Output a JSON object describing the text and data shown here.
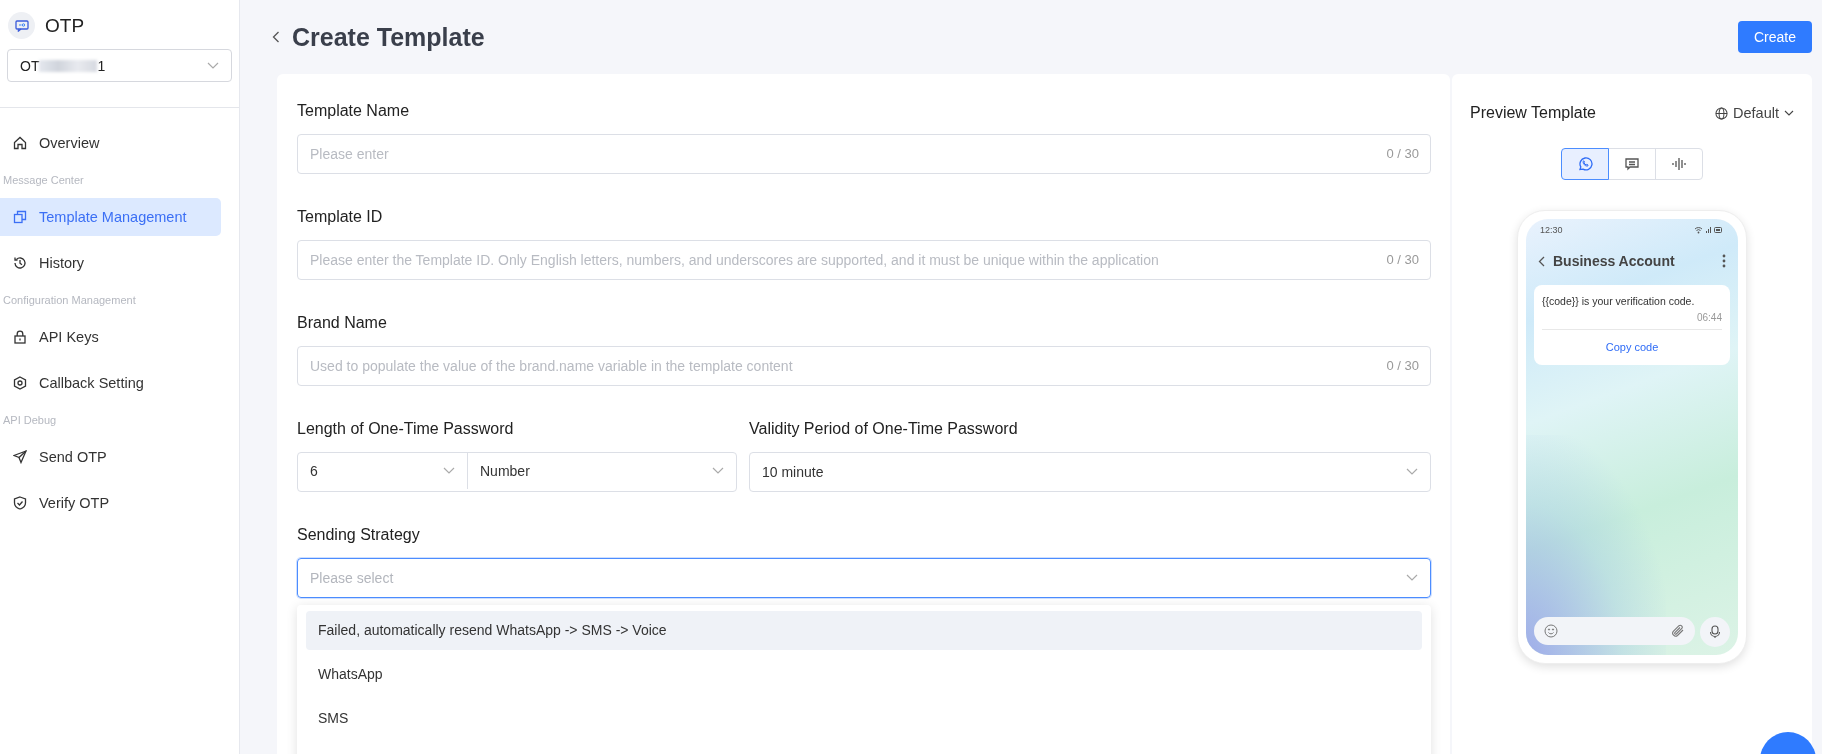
{
  "app": {
    "name": "OTP",
    "selector": {
      "value_start": "OT",
      "value_end": "1"
    }
  },
  "sidebar": {
    "items": [
      {
        "kind": "item",
        "label": "Overview",
        "selected": false
      },
      {
        "kind": "section",
        "label": "Message Center"
      },
      {
        "kind": "item",
        "label": "Template Management",
        "selected": true
      },
      {
        "kind": "item",
        "label": "History",
        "selected": false
      },
      {
        "kind": "section",
        "label": "Configuration Management"
      },
      {
        "kind": "item",
        "label": "API Keys",
        "selected": false
      },
      {
        "kind": "item",
        "label": "Callback Setting",
        "selected": false
      },
      {
        "kind": "section",
        "label": "API Debug"
      },
      {
        "kind": "item",
        "label": "Send OTP",
        "selected": false
      },
      {
        "kind": "item",
        "label": "Verify OTP",
        "selected": false
      }
    ]
  },
  "header": {
    "title": "Create Template",
    "create_button": "Create"
  },
  "form": {
    "text_fields": [
      {
        "label": "Template Name",
        "placeholder": "Please enter",
        "count": "0 / 30"
      },
      {
        "label": "Template ID",
        "placeholder": "Please enter the Template ID. Only English letters, numbers, and underscores are supported, and it must be unique within the application",
        "count": "0 / 30"
      },
      {
        "label": "Brand Name",
        "placeholder": "Used to populate the value of the brand.name variable in the template content",
        "count": "0 / 30"
      }
    ],
    "password_length": {
      "label": "Length of One-Time Password",
      "digits": "6",
      "type": "Number"
    },
    "validity": {
      "label": "Validity Period of One-Time Password",
      "value": "10 minute"
    },
    "sending_strategy": {
      "label": "Sending Strategy",
      "placeholder": "Please select",
      "focused": true,
      "options": [
        {
          "label": "Failed, automatically resend WhatsApp -> SMS -> Voice",
          "highlighted": true
        },
        {
          "label": "WhatsApp",
          "highlighted": false
        },
        {
          "label": "SMS",
          "highlighted": false
        }
      ]
    }
  },
  "preview": {
    "title": "Preview Template",
    "language": "Default",
    "channels": [
      {
        "selected": true
      },
      {
        "selected": false
      },
      {
        "selected": false
      }
    ],
    "phone": {
      "time": "12:30",
      "contact": "Business Account",
      "message": "{{code}} is your verification code.",
      "message_time": "06:44",
      "action": "Copy code"
    }
  }
}
